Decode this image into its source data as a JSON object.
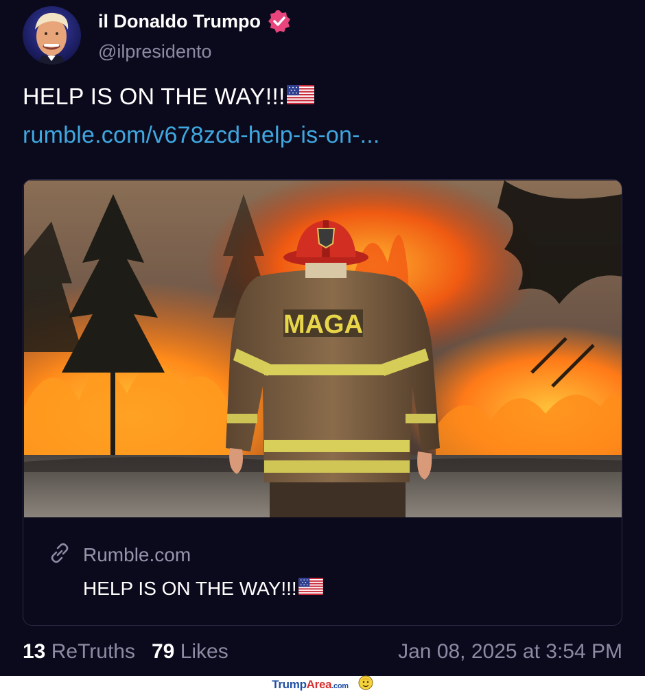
{
  "author": {
    "display_name": "il Donaldo Trumpo",
    "handle": "@ilpresidento",
    "verified": true
  },
  "post": {
    "text": "HELP IS ON THE WAY!!!",
    "link": "rumble.com/v678zcd-help-is-on-..."
  },
  "card": {
    "image_label": "MAGA",
    "domain": "Rumble.com",
    "title": "HELP IS ON THE WAY!!!"
  },
  "stats": {
    "retruths_count": "13",
    "retruths_label": "ReTruths",
    "likes_count": "79",
    "likes_label": "Likes",
    "timestamp": "Jan 08, 2025 at 3:54 PM"
  },
  "footer": {
    "brand_part1": "Trump",
    "brand_part2": "Area",
    "brand_part3": ".com"
  },
  "colors": {
    "background": "#0b0a1c",
    "link": "#3fa8e0",
    "muted": "#8d8ba3",
    "verified": "#e9457c"
  },
  "icons": [
    "verified-badge-icon",
    "us-flag-icon",
    "link-chain-icon",
    "smiley-face-icon"
  ]
}
